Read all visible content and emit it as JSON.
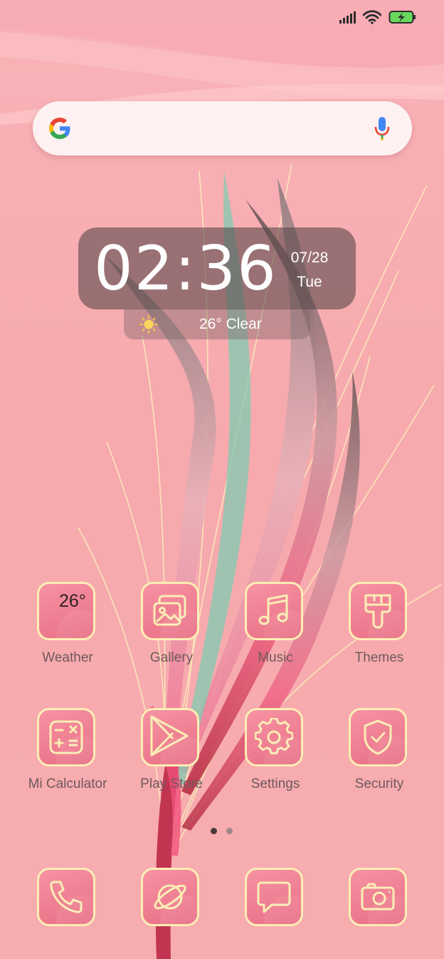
{
  "status_bar": {
    "signal_icon": "signal-icon",
    "wifi_icon": "wifi-icon",
    "battery_icon": "battery-charging-icon",
    "battery_color": "#6ad85c"
  },
  "search_bar": {
    "logo_icon": "google-icon",
    "mic_icon": "mic-icon"
  },
  "clock_widget": {
    "time": "02:36",
    "date": "07/28",
    "day": "Tue",
    "weather_text": "26° Clear",
    "weather_icon": "sun-icon"
  },
  "apps": [
    {
      "label": "Weather",
      "icon": "weather-icon",
      "temp": "26°"
    },
    {
      "label": "Gallery",
      "icon": "gallery-icon"
    },
    {
      "label": "Music",
      "icon": "music-icon"
    },
    {
      "label": "Themes",
      "icon": "themes-icon"
    },
    {
      "label": "Mi Calculator",
      "icon": "calculator-icon"
    },
    {
      "label": "Play Store",
      "icon": "play-store-icon"
    },
    {
      "label": "Settings",
      "icon": "gear-icon"
    },
    {
      "label": "Security",
      "icon": "shield-icon"
    }
  ],
  "dock": [
    {
      "icon": "phone-icon"
    },
    {
      "icon": "browser-icon"
    },
    {
      "icon": "messages-icon"
    },
    {
      "icon": "camera-icon"
    }
  ],
  "page_indicator": {
    "pages": 2,
    "active": 0
  },
  "colors": {
    "tile_border": "#fbeeb4",
    "tile_fill": "#ef7f92",
    "label": "#6e5a5c",
    "widget_bg": "#5a484a"
  }
}
